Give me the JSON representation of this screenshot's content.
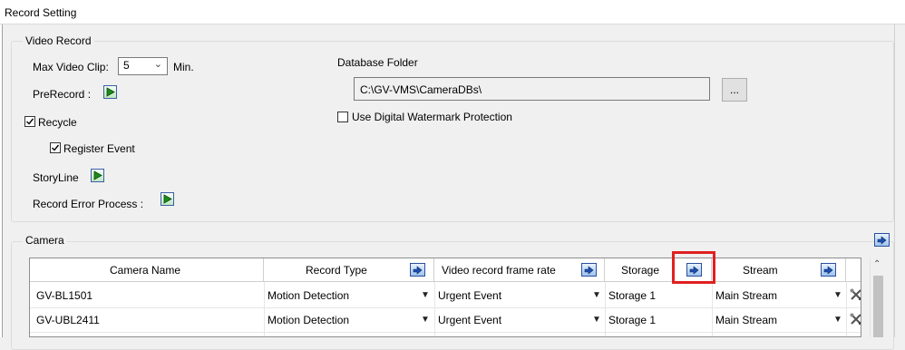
{
  "window": {
    "title": "Record Setting"
  },
  "video_record": {
    "group_label": "Video Record",
    "max_clip_label": "Max Video Clip:",
    "max_clip_value": "5",
    "max_clip_unit": "Min.",
    "prerecord_label": "PreRecord :",
    "recycle_label": "Recycle",
    "recycle_checked": true,
    "register_event_label": "Register Event",
    "register_event_checked": true,
    "storyline_label": "StoryLine",
    "record_error_label": "Record Error Process :",
    "db_folder_label": "Database Folder",
    "db_folder_value": "C:\\GV-VMS\\CameraDBs\\",
    "browse_label": "...",
    "watermark_label": "Use Digital Watermark Protection",
    "watermark_checked": false
  },
  "camera": {
    "group_label": "Camera",
    "columns": {
      "name": "Camera Name",
      "record_type": "Record Type",
      "frame_rate": "Video record frame rate",
      "storage": "Storage",
      "stream": "Stream"
    },
    "rows": [
      {
        "name": "GV-BL1501",
        "record_type": "Motion Detection",
        "frame_rate": "Urgent Event",
        "storage": "Storage 1",
        "stream": "Main Stream"
      },
      {
        "name": "GV-UBL2411",
        "record_type": "Motion Detection",
        "frame_rate": "Urgent Event",
        "storage": "Storage 1",
        "stream": "Main Stream"
      }
    ]
  },
  "colors": {
    "highlight": "#e02020",
    "icon_blue": "#2b4f9e",
    "play_green": "#1c8a1c"
  },
  "icons": {
    "play": "play-triangle-icon",
    "batch_apply": "batch-apply-icon",
    "settings_tool": "tools-icon",
    "dropdown": "chevron-down-icon",
    "scroll_up": "scroll-up-arrow-icon"
  }
}
